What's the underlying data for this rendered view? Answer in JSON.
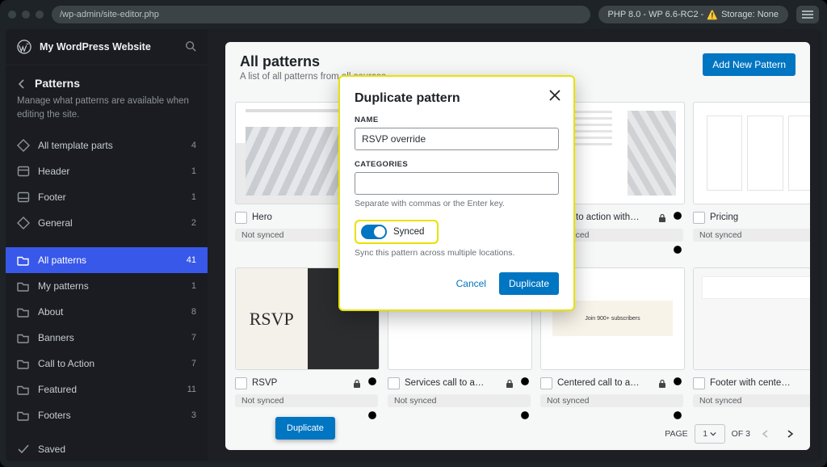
{
  "browser": {
    "url": "/wp-admin/site-editor.php",
    "status": "PHP 8.0 - WP 6.6-RC2 -",
    "storage": "Storage: None"
  },
  "site_name": "My WordPress Website",
  "nav": {
    "section_title": "Patterns",
    "section_desc": "Manage what patterns are available when editing the site.",
    "template_parts": [
      {
        "label": "All template parts",
        "count": 4
      },
      {
        "label": "Header",
        "count": 1
      },
      {
        "label": "Footer",
        "count": 1
      },
      {
        "label": "General",
        "count": 2
      }
    ],
    "pattern_cats": [
      {
        "label": "All patterns",
        "count": 41,
        "active": true
      },
      {
        "label": "My patterns",
        "count": 1
      },
      {
        "label": "About",
        "count": 8
      },
      {
        "label": "Banners",
        "count": 7
      },
      {
        "label": "Call to Action",
        "count": 7
      },
      {
        "label": "Featured",
        "count": 11
      },
      {
        "label": "Footers",
        "count": 3
      }
    ],
    "saved_label": "Saved"
  },
  "header": {
    "title": "All patterns",
    "subtitle": "A list of all patterns from all sources.",
    "add_label": "Add New Pattern"
  },
  "chips": {
    "not_synced": "Not synced"
  },
  "row1": [
    {
      "title": "Hero",
      "lock": false
    },
    {
      "title": "",
      "lock": false
    },
    {
      "title": "Call to action with…",
      "lock": true
    },
    {
      "title": "Pricing",
      "lock": true
    }
  ],
  "row2": [
    {
      "title": "RSVP",
      "lock": true
    },
    {
      "title": "Services call to a…",
      "lock": true
    },
    {
      "title": "Centered call to a…",
      "lock": true
    },
    {
      "title": "Footer with cente…",
      "lock": true
    }
  ],
  "cta_band_text": "Join 900+ subscribers",
  "tooltip": "Duplicate",
  "pagination": {
    "label_page": "PAGE",
    "current": "1",
    "total_suffix": "OF 3"
  },
  "modal": {
    "title": "Duplicate pattern",
    "name_label": "NAME",
    "name_value": "RSVP override",
    "cat_label": "CATEGORIES",
    "cat_hint": "Separate with commas or the Enter key.",
    "synced_label": "Synced",
    "synced_hint": "Sync this pattern across multiple locations.",
    "cancel": "Cancel",
    "confirm": "Duplicate"
  }
}
